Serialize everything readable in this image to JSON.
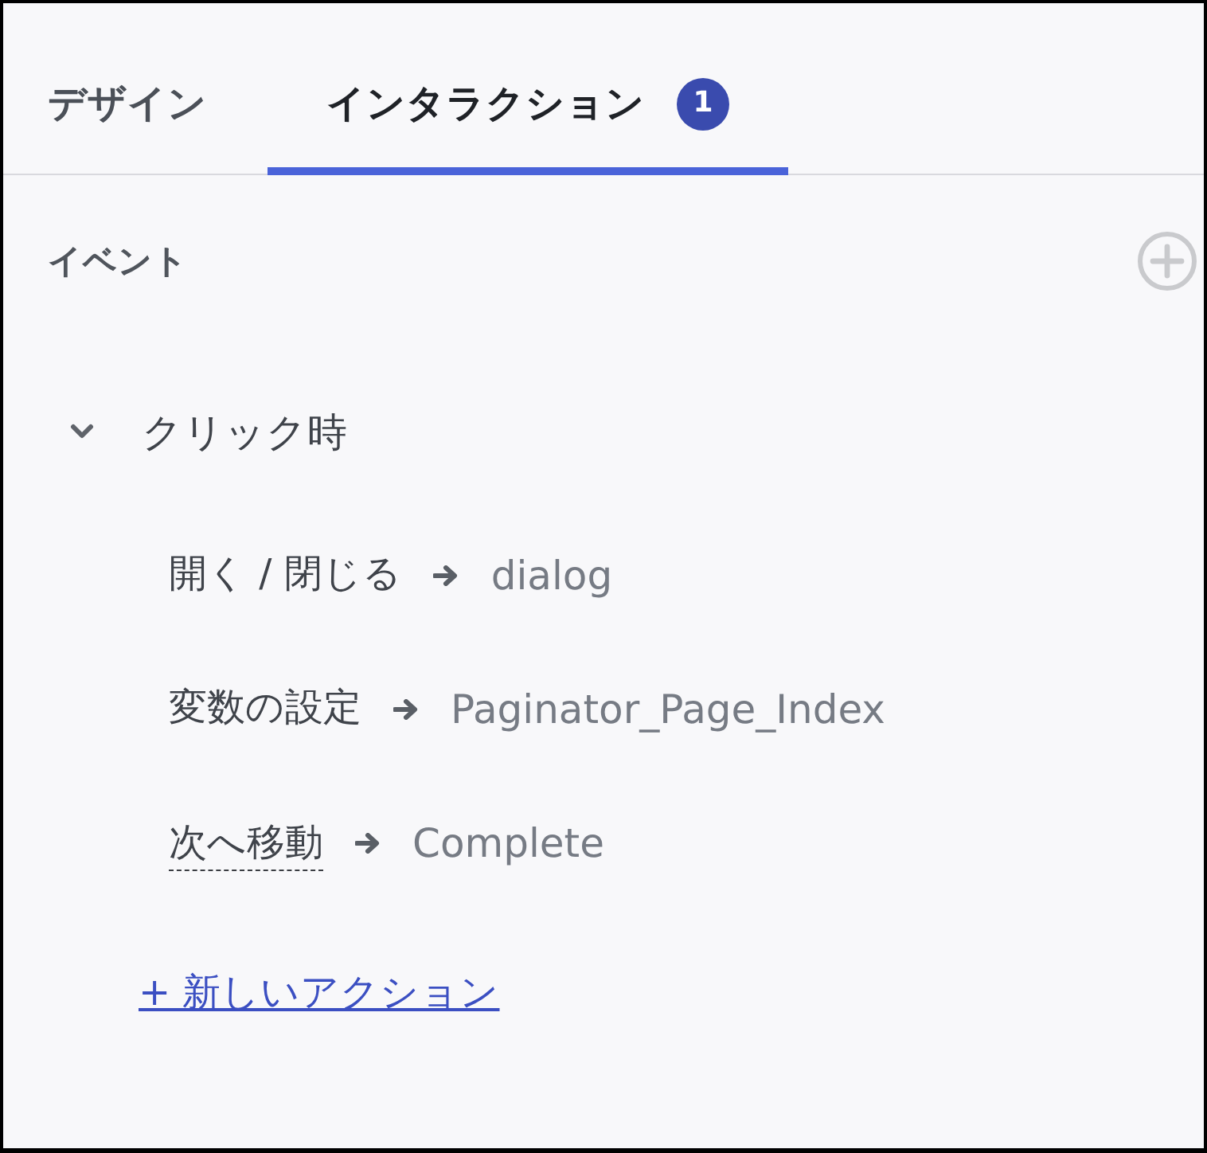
{
  "tabs": [
    {
      "label": "デザイン",
      "selected": false
    },
    {
      "label": "インタラクション",
      "selected": true,
      "badge": "1"
    }
  ],
  "events": {
    "title": "イベント",
    "items": [
      {
        "label": "クリック時",
        "expanded": true,
        "actions": [
          {
            "label": "開く / 閉じる",
            "target": "dialog",
            "underlined": false
          },
          {
            "label": "変数の設定",
            "target": "Paginator_Page_Index",
            "underlined": false
          },
          {
            "label": "次へ移動",
            "target": "Complete",
            "underlined": true
          }
        ],
        "add_action": "+ 新しいアクション"
      }
    ]
  }
}
